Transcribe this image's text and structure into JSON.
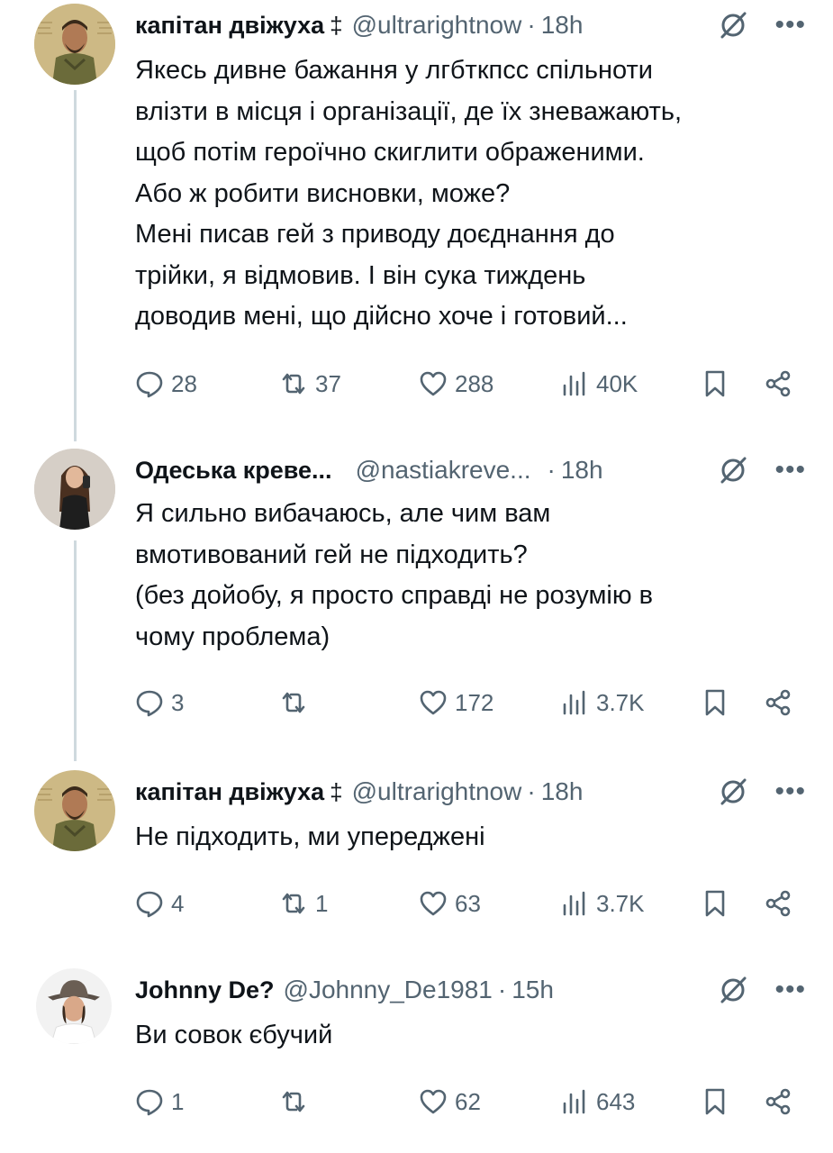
{
  "tweets": [
    {
      "name": "капітан двіжуха",
      "badge": "‡",
      "handle": "@ultrarightnow",
      "sep": "·",
      "time": "18h",
      "text": "Якесь дивне бажання у лгбткпсс спільноти\nвлізти в місця і організації, де їх зневажають,\nщоб потім героїчно скиглити ображеними.\nАбо ж робити висновки, може?\nМені писав гей з приводу доєднання до\nтрійки, я відмовив. І він сука тиждень\nдоводив мені, що дійсно хоче і готовий...",
      "replies": "28",
      "reposts": "37",
      "likes": "288",
      "views": "40K",
      "avatar_icon": "military-portrait-avatar"
    },
    {
      "name": "Одеська креве...",
      "badge": "",
      "handle": "@nastiakreve...",
      "sep": "·",
      "time": "18h",
      "text": "Я сильно вибачаюсь, але чим вам\nвмотивований гей не підходить?\n(без дойобу, я просто справді не розумію в\nчому проблема)",
      "replies": "3",
      "reposts": "",
      "likes": "172",
      "views": "3.7K",
      "avatar_icon": "woman-selfie-avatar"
    },
    {
      "name": "капітан двіжуха",
      "badge": "‡",
      "handle": "@ultrarightnow",
      "sep": "·",
      "time": "18h",
      "text": "Не підходить, ми упереджені",
      "replies": "4",
      "reposts": "1",
      "likes": "63",
      "views": "3.7K",
      "avatar_icon": "military-portrait-avatar"
    },
    {
      "name": "Johnny De?",
      "badge": "",
      "handle": "@Johnny_De1981",
      "sep": "·",
      "time": "15h",
      "text": "Ви совок єбучий",
      "replies": "1",
      "reposts": "",
      "likes": "62",
      "views": "643",
      "avatar_icon": "man-hat-avatar"
    }
  ],
  "colors": {
    "text": "#0f1419",
    "secondary": "#536471",
    "thread_line": "#cfd9de"
  }
}
